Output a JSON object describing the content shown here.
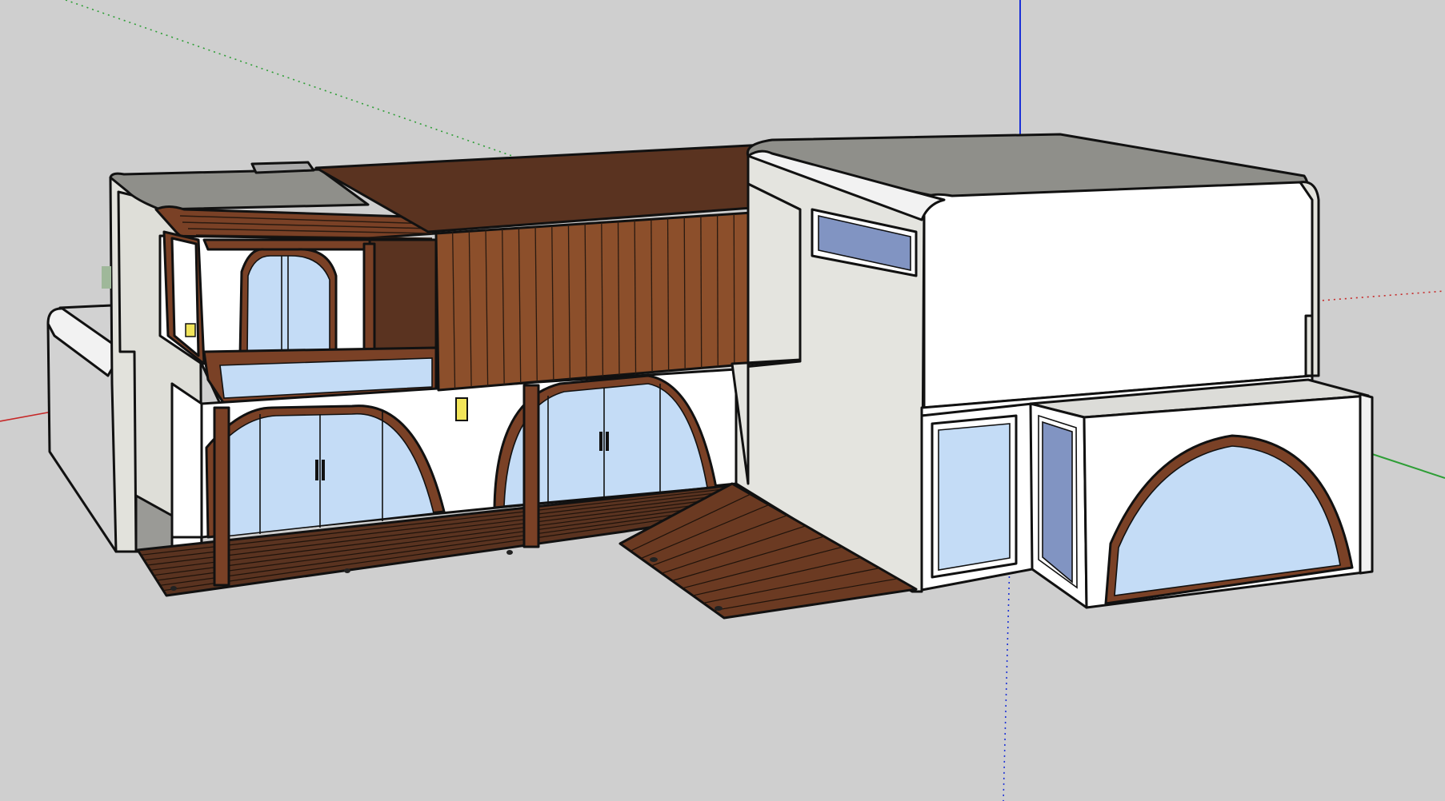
{
  "viewport": {
    "background": "#cfcfcf",
    "axis_colors": {
      "red": "#c62828",
      "green": "#2e9e36",
      "blue": "#1a2fd6"
    }
  },
  "model": {
    "palette": {
      "wall_white": "#ffffff",
      "wall_grey": "#dcdcd8",
      "wall_shadow": "#bdbdbd",
      "roof_grey": "#8f8f8a",
      "wood_dark": "#5a3320",
      "wood_mid": "#7a4126",
      "wood_light": "#8c4f2b",
      "glass_light": "#c4dcf6",
      "glass_dark": "#8194c2",
      "lamp": "#f2e55a"
    }
  }
}
